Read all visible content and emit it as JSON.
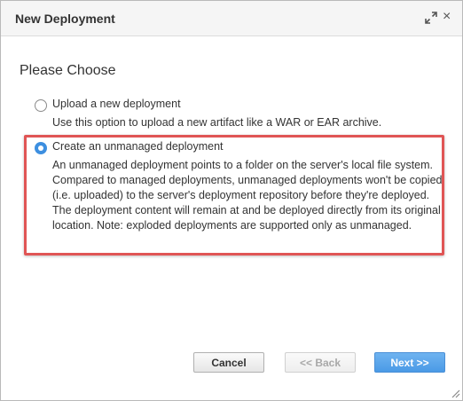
{
  "dialog": {
    "title": "New Deployment",
    "maximize_icon": "maximize-icon",
    "close_glyph": "×"
  },
  "content": {
    "heading": "Please Choose",
    "options": [
      {
        "label": "Upload a new deployment",
        "description": "Use this option to upload a new artifact like a WAR or EAR archive.",
        "selected": false
      },
      {
        "label": "Create an unmanaged deployment",
        "description": "An unmanaged deployment points to a folder on the server's local file system. Compared to managed deployments, unmanaged deployments won't be copied (i.e. uploaded) to the server's deployment repository before they're deployed. The deployment content will remain at and be deployed directly from its original location. Note: exploded deployments are supported only as unmanaged.",
        "selected": true
      }
    ]
  },
  "footer": {
    "cancel_label": "Cancel",
    "back_label": "<< Back",
    "next_label": "Next >>"
  },
  "colors": {
    "accent": "#3d8fe0",
    "highlight": "#e05555",
    "next_button": "#4a9ae6"
  }
}
